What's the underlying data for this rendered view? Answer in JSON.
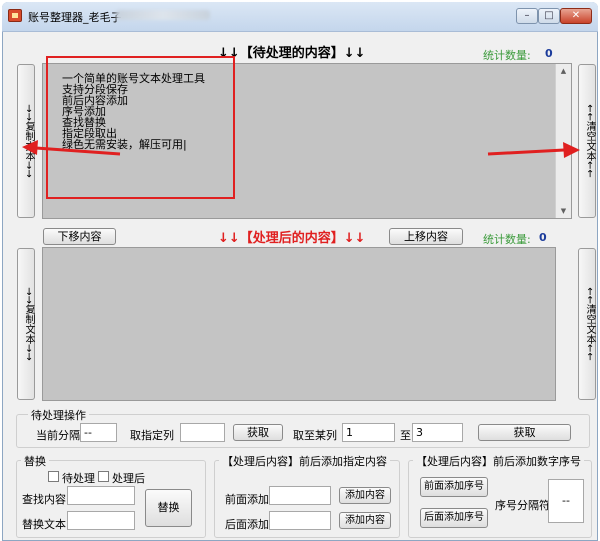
{
  "window": {
    "title": "账号整理器_老毛子",
    "controls": {
      "minimize": "–",
      "maximize": "□",
      "close": "✕"
    }
  },
  "top_panel": {
    "heading": "↓↓【待处理的内容】↓↓",
    "count_label": "统计数量:",
    "count_value": "0",
    "left_button": "→→复制文本→→",
    "right_button": "←←清空文本←←",
    "content_lines": [
      "一个简单的账号文本处理工具",
      "支持分段保存",
      "前后内容添加",
      "序号添加",
      "查找替换",
      "指定段取出",
      "绿色无需安装，解压可用|"
    ]
  },
  "middle_bar": {
    "move_down": "下移内容",
    "heading": "↓↓【处理后的内容】↓↓",
    "move_up": "上移内容",
    "count_label": "统计数量:",
    "count_value": "0"
  },
  "bottom_panel": {
    "left_button": "→→复制文本→→",
    "right_button": "←←清空文本←←"
  },
  "pending_ops": {
    "group_label": "待处理操作",
    "separator_label": "当前分隔",
    "separator_value": "--",
    "column_label": "取指定列",
    "column_value": "",
    "get_button_1": "获取",
    "range_label": "取至某列",
    "range_from": "1",
    "range_to_label": "至",
    "range_to": "3",
    "get_button_2": "获取"
  },
  "replace": {
    "group_label": "替换",
    "check_pending": "待处理",
    "check_processed": "处理后",
    "find_label": "查找内容",
    "find_value": "",
    "replace_label": "替换文本",
    "replace_value": "",
    "replace_button": "替换"
  },
  "add_content": {
    "group_label": "【处理后内容】前后添加指定内容",
    "front_label": "前面添加",
    "front_value": "",
    "front_button": "添加内容",
    "back_label": "后面添加",
    "back_value": "",
    "back_button": "添加内容"
  },
  "add_number": {
    "group_label": "【处理后内容】前后添加数字序号",
    "front_button": "前面添加序号",
    "back_button": "后面添加序号",
    "sep_label": "序号分隔符",
    "sep_value": "--"
  },
  "colors": {
    "annotation": "#e02020",
    "count_label": "#3a9a3a",
    "count_value": "#1b3b9b"
  }
}
